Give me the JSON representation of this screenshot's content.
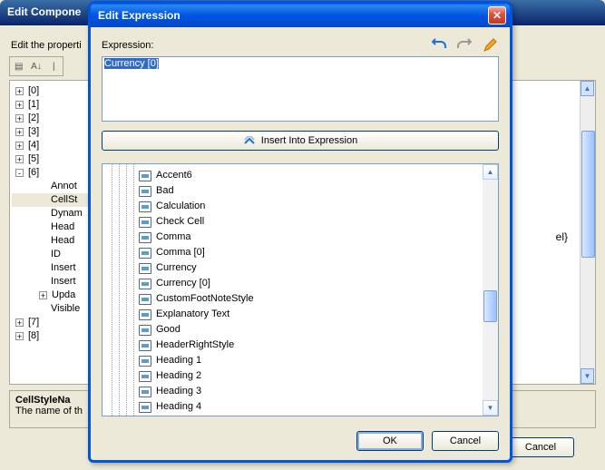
{
  "bg": {
    "title": "Edit Compone",
    "prompt": "Edit the properti",
    "tree": {
      "nodes": [
        {
          "expand": "+",
          "label": "[0]",
          "lvl": 1
        },
        {
          "expand": "+",
          "label": "[1]",
          "lvl": 1
        },
        {
          "expand": "+",
          "label": "[2]",
          "lvl": 1
        },
        {
          "expand": "+",
          "label": "[3]",
          "lvl": 1
        },
        {
          "expand": "+",
          "label": "[4]",
          "lvl": 1
        },
        {
          "expand": "+",
          "label": "[5]",
          "lvl": 1
        },
        {
          "expand": "-",
          "label": "[6]",
          "lvl": 1
        },
        {
          "expand": "",
          "label": "Annot",
          "lvl": 2
        },
        {
          "expand": "",
          "label": "CellSt",
          "lvl": 2,
          "sel": true
        },
        {
          "expand": "",
          "label": "Dynam",
          "lvl": 2
        },
        {
          "expand": "",
          "label": "Head",
          "lvl": 2
        },
        {
          "expand": "",
          "label": "Head",
          "lvl": 2
        },
        {
          "expand": "",
          "label": "ID",
          "lvl": 2
        },
        {
          "expand": "",
          "label": "Insert",
          "lvl": 2
        },
        {
          "expand": "",
          "label": "Insert",
          "lvl": 2
        },
        {
          "expand": "+",
          "label": "Upda",
          "lvl": 2
        },
        {
          "expand": "",
          "label": "Visible",
          "lvl": 2
        },
        {
          "expand": "+",
          "label": "[7]",
          "lvl": 1
        },
        {
          "expand": "+",
          "label": "[8]",
          "lvl": 1
        }
      ]
    },
    "bracket": "el}",
    "footer_title": "CellStyleNa",
    "footer_text": "The name of th",
    "cancel": "Cancel"
  },
  "dlg": {
    "title": "Edit Expression",
    "expr_label": "Expression:",
    "expr_value": "Currency [0]",
    "insert_label": "Insert Into Expression",
    "items": [
      "Accent6",
      "Bad",
      "Calculation",
      "Check Cell",
      "Comma",
      "Comma [0]",
      "Currency",
      "Currency [0]",
      "CustomFootNoteStyle",
      "Explanatory Text",
      "Good",
      "HeaderRightStyle",
      "Heading 1",
      "Heading 2",
      "Heading 3",
      "Heading 4"
    ],
    "ok": "OK",
    "cancel": "Cancel"
  }
}
